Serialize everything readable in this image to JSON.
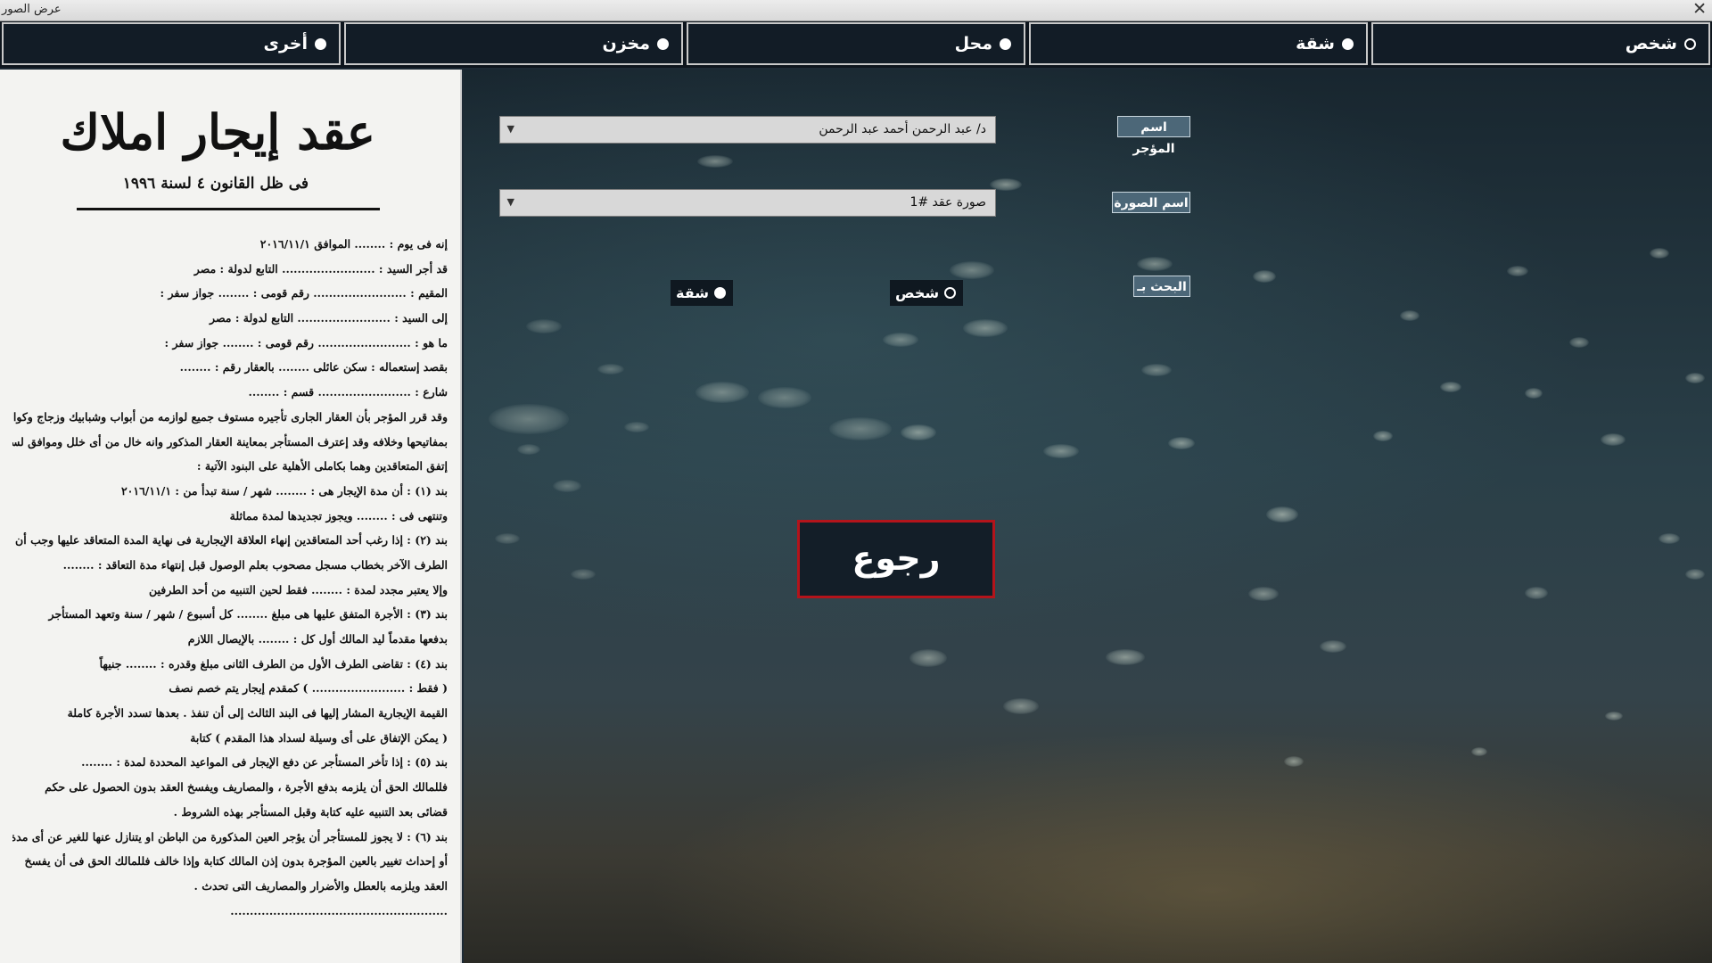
{
  "window": {
    "title": "عرض الصور",
    "close_glyph": "✕"
  },
  "tabs": [
    {
      "label": "شخص",
      "selected": false
    },
    {
      "label": "شقة",
      "selected": true
    },
    {
      "label": "محل",
      "selected": true
    },
    {
      "label": "مخزن",
      "selected": true
    },
    {
      "label": "أخرى",
      "selected": true
    }
  ],
  "form": {
    "owner_label": "اسم المؤجر",
    "owner_value": "د/ عبد الرحمن أحمد عبد الرحمن",
    "image_label": "اسم الصورة",
    "image_value": "صورة عقد #1",
    "search_by_label": "البحث بـ",
    "search_options": [
      {
        "label": "شخص",
        "selected": false
      },
      {
        "label": "شقة",
        "selected": true
      }
    ],
    "back_button": "رجوع"
  },
  "document": {
    "title": "عقد إيجار املاك",
    "subtitle": "فى ظل القانون ٤ لسنة ١٩٩٦",
    "lines": [
      "إنه فى يوم : ........ الموافق ٢٠١٦/١١/١",
      "قد أجر السيد : ........................ التابع لدولة : مصر",
      "المقيم : ........................ رقم قومى : ........ جواز سفر :",
      "إلى السيد : ........................ التابع لدولة : مصر",
      "ما هو : ........................ رقم قومى : ........ جواز سفر :",
      "بقصد إستعماله : سكن عائلى ........ بالعقار رقم : ........",
      "شارع : ........................ قسم : ........",
      "وقد قرر المؤجر بأن العقار الجارى تأجيره مستوف جميع لوازمه من أبواب وشبابيك وزجاج وكوالين",
      "بمفاتيحها وخلافه وقد إعترف المستأجر بمعاينة العقار المذكور وانه خال من أى خلل وموافق لسكنه وقد",
      "إتفق المتعاقدين وهما بكاملى الأهلية على البنود الآتية :",
      "بند (١) : أن مدة الإيجار هى : ........ شهر / سنة تبدأ من : ٢٠١٦/١١/١",
      "وتنتهى فى : ........ ويجوز تجديدها لمدة مماثلة",
      "بند (٢) : إذا رغب أحد المتعاقدين إنهاء العلاقة الإيجارية فى نهاية المدة المتعاقد عليها وجب أن يعلن",
      "الطرف الآخر بخطاب مسجل مصحوب بعلم الوصول قبل إنتهاء مدة التعاقد : ........",
      "وإلا يعتبر مجدد لمدة : ........ فقط لحين التنبيه من أحد الطرفين",
      "بند (٣) : الأجرة المتفق عليها هى مبلغ ........ كل أسبوع / شهر / سنة وتعهد المستأجر",
      "بدفعها مقدماً ليد المالك أول كل : ........ بالإيصال اللازم",
      "بند (٤) : تقاضى الطرف الأول من الطرف الثانى مبلغ وقدره : ........ جنيهاً",
      "( فقط : ........................ ) كمقدم إيجار يتم خصم نصف",
      "القيمة الإيجارية المشار إليها فى البند الثالث إلى أن تنفذ . بعدها تسدد الأجرة كاملة",
      "( يمكن الإتفاق على أى وسيلة لسداد هذا المقدم ) كتابة",
      "بند (٥) : إذا تأخر المستأجر عن دفع الإيجار فى المواعيد المحددة لمدة : ........",
      "فللمالك الحق أن يلزمه بدفع الأجرة ، والمصاريف ويفسخ العقد بدون الحصول على حكم",
      "قضائى بعد التنبيه عليه كتابة وقبل المستأجر بهذه الشروط .",
      "بند (٦) : لا يجوز للمستأجر أن يؤجر العين المذكورة من الباطن او يتنازل عنها للغير عن أى مدة كانت",
      "أو إحداث تغيير بالعين المؤجرة بدون إذن المالك كتابة وإذا خالف فللمالك الحق فى أن يفسخ",
      "العقد ويلزمه بالعطل والأضرار والمصاريف التى تحدث .",
      "........................................................"
    ]
  }
}
